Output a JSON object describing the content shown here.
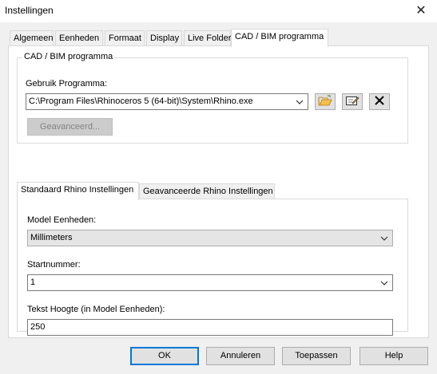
{
  "window": {
    "title": "Instellingen",
    "close_glyph": "✕"
  },
  "tabs": [
    {
      "label": "Algemeen"
    },
    {
      "label": "Eenheden"
    },
    {
      "label": "Formaat"
    },
    {
      "label": "Display"
    },
    {
      "label": "Live Folder"
    },
    {
      "label": "CAD / BIM programma",
      "active": true
    }
  ],
  "cad_group": {
    "legend": "CAD / BIM programma",
    "program_label": "Gebruik Programma:",
    "program_path": "C:\\Program Files\\Rhinoceros 5 (64-bit)\\System\\Rhino.exe",
    "advanced_button": "Geavanceerd...",
    "icons": [
      "folder-open-icon",
      "edit-icon",
      "delete-x-icon"
    ]
  },
  "inner_tabs": [
    {
      "label": "Standaard Rhino Instellingen",
      "active": true
    },
    {
      "label": "Geavanceerde Rhino Instellingen"
    }
  ],
  "rhino_settings": {
    "model_units_label": "Model Eenheden:",
    "model_units_value": "Millimeters",
    "start_number_label": "Startnummer:",
    "start_number_value": "1",
    "text_height_label": "Tekst Hoogte (in Model Eenheden):",
    "text_height_value": "250"
  },
  "buttons": {
    "ok": "OK",
    "cancel": "Annuleren",
    "apply": "Toepassen",
    "help": "Help"
  },
  "colors": {
    "accent": "#0078d7",
    "client_bg": "#f0f0f0"
  }
}
